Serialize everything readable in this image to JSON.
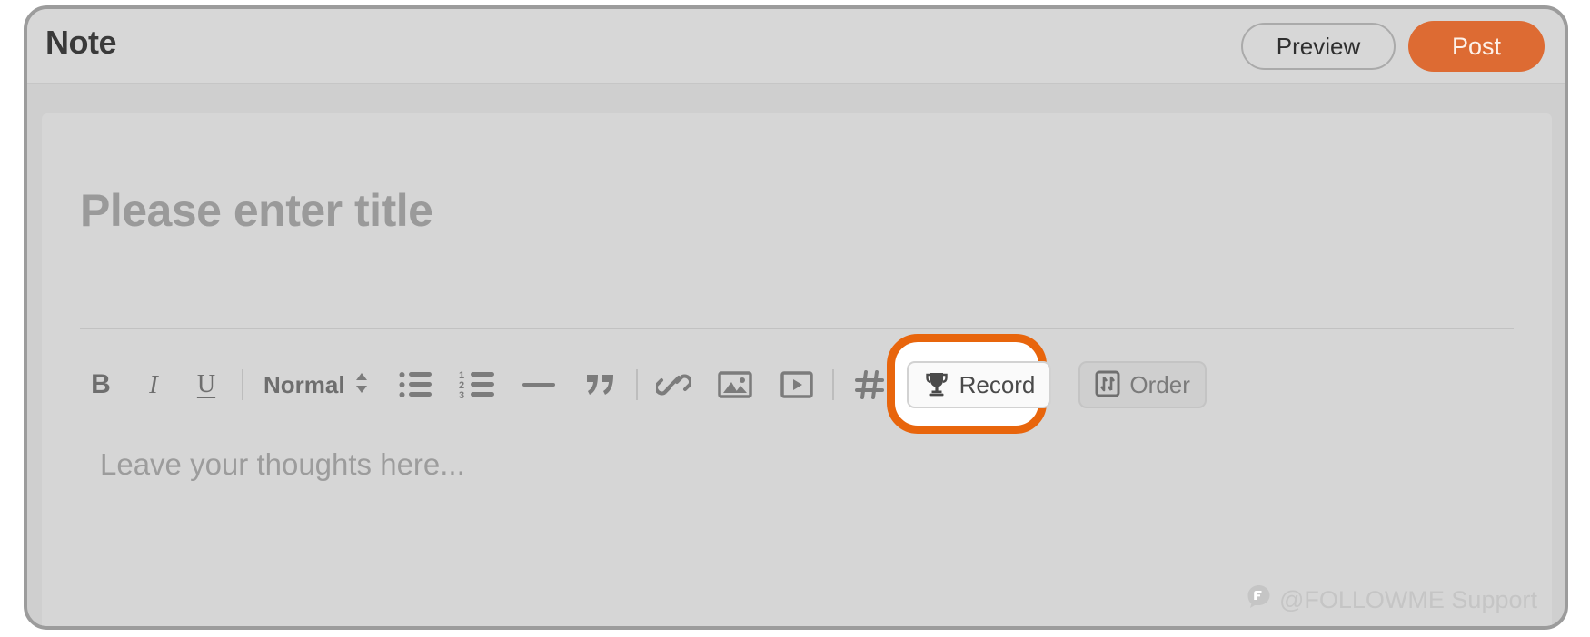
{
  "window": {
    "header": {
      "title": "Note",
      "preview_label": "Preview",
      "post_label": "Post",
      "post_color": "#dd6b33"
    }
  },
  "editor": {
    "title_placeholder": "Please enter title",
    "content_placeholder": "Leave your thoughts here...",
    "toolbar": {
      "bold_label": "B",
      "italic_label": "I",
      "underline_label": "U",
      "block_format_value": "Normal",
      "bullet_list_icon": "bullet-list-icon",
      "numbered_list_icon": "numbered-list-icon",
      "horizontal_rule_icon": "horizontal-rule-icon",
      "blockquote_icon": "blockquote-icon",
      "link_icon": "link-icon",
      "image_icon": "image-icon",
      "video_icon": "video-icon",
      "hashtag_icon": "hashtag-icon",
      "record_label": "Record",
      "record_icon": "trophy-icon",
      "order_label": "Order",
      "order_icon": "order-arrows-icon"
    }
  },
  "highlight": {
    "target": "record-button",
    "ring_color": "#e8650c"
  },
  "watermark": {
    "text": "@FOLLOWME Support",
    "logo_icon": "followme-logo-icon"
  }
}
